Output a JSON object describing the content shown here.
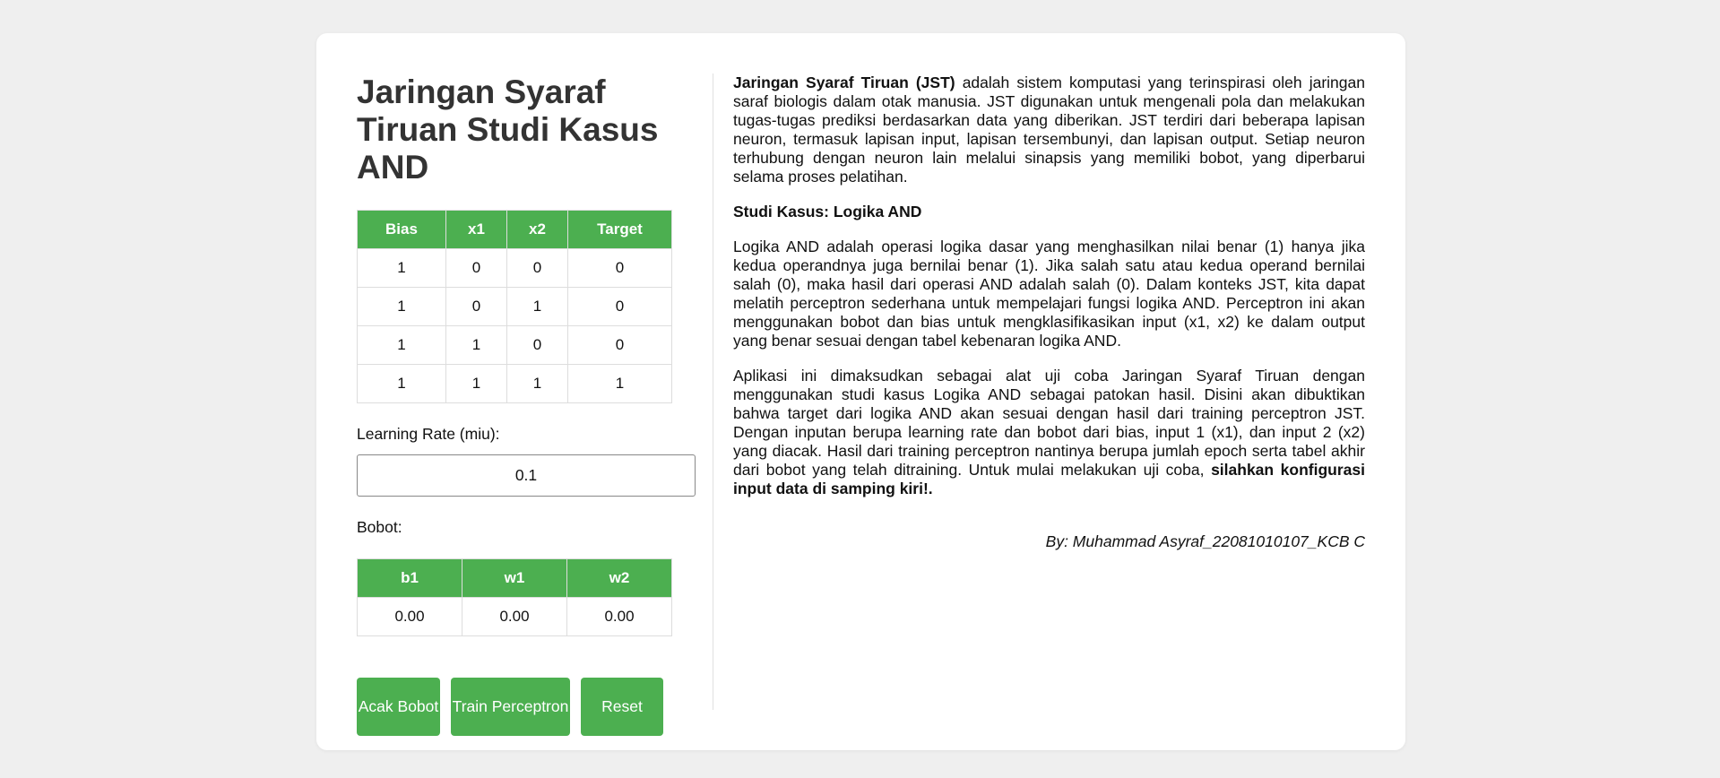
{
  "left": {
    "title": "Jaringan Syaraf Tiruan Studi Kasus AND",
    "truth_table": {
      "headers": [
        "Bias",
        "x1",
        "x2",
        "Target"
      ],
      "rows": [
        [
          "1",
          "0",
          "0",
          "0"
        ],
        [
          "1",
          "0",
          "1",
          "0"
        ],
        [
          "1",
          "1",
          "0",
          "0"
        ],
        [
          "1",
          "1",
          "1",
          "1"
        ]
      ]
    },
    "learning_rate_label": "Learning Rate (miu):",
    "learning_rate_value": "0.1",
    "weights_label": "Bobot:",
    "weights_table": {
      "headers": [
        "b1",
        "w1",
        "w2"
      ],
      "values": [
        "0.00",
        "0.00",
        "0.00"
      ]
    },
    "buttons": {
      "acak": "Acak Bobot",
      "train": "Train Perceptron",
      "reset": "Reset"
    }
  },
  "right": {
    "intro_bold": "Jaringan Syaraf Tiruan (JST)",
    "intro_text": " adalah sistem komputasi yang terinspirasi oleh jaringan saraf biologis dalam otak manusia. JST digunakan untuk mengenali pola dan melakukan tugas-tugas prediksi berdasarkan data yang diberikan. JST terdiri dari beberapa lapisan neuron, termasuk lapisan input, lapisan tersembunyi, dan lapisan output. Setiap neuron terhubung dengan neuron lain melalui sinapsis yang memiliki bobot, yang diperbarui selama proses pelatihan.",
    "case_heading": "Studi Kasus: Logika AND",
    "case_text": "Logika AND adalah operasi logika dasar yang menghasilkan nilai benar (1) hanya jika kedua operandnya juga bernilai benar (1). Jika salah satu atau kedua operand bernilai salah (0), maka hasil dari operasi AND adalah salah (0). Dalam konteks JST, kita dapat melatih perceptron sederhana untuk mempelajari fungsi logika AND. Perceptron ini akan menggunakan bobot dan bias untuk mengklasifikasikan input (x1, x2) ke dalam output yang benar sesuai dengan tabel kebenaran logika AND.",
    "app_text": "Aplikasi ini dimaksudkan sebagai alat uji coba Jaringan Syaraf Tiruan dengan menggunakan studi kasus Logika AND sebagai patokan hasil. Disini akan dibuktikan bahwa target dari logika AND akan sesuai dengan hasil dari training perceptron JST. Dengan inputan berupa learning rate dan bobot dari bias, input 1 (x1), dan input 2 (x2) yang diacak. Hasil dari training perceptron nantinya berupa jumlah epoch serta tabel akhir dari bobot yang telah ditraining. Untuk mulai melakukan uji coba, ",
    "app_bold": "silahkan konfigurasi input data di samping kiri!.",
    "byline": "By: Muhammad Asyraf_22081010107_KCB C"
  },
  "colors": {
    "accent": "#4caf50",
    "background": "#efefef",
    "card": "#ffffff"
  }
}
